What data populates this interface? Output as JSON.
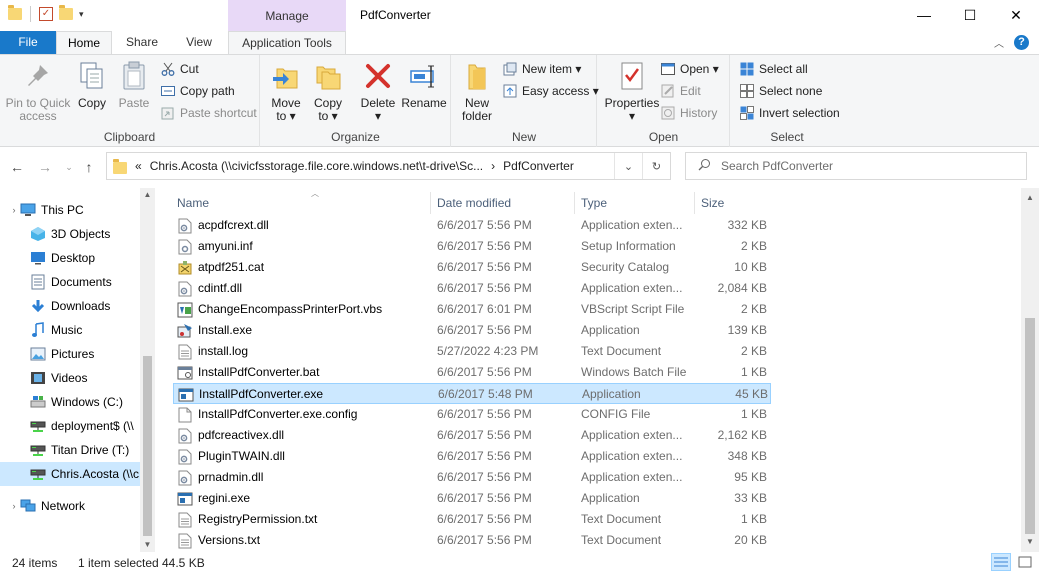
{
  "titlebar": {
    "manage_label": "Manage",
    "window_title": "PdfConverter",
    "minimize": "—",
    "maximize": "☐",
    "close": "✕"
  },
  "tabs": {
    "file": "File",
    "home": "Home",
    "share": "Share",
    "view": "View",
    "app_tools": "Application Tools"
  },
  "ribbon": {
    "clipboard": {
      "label": "Clipboard",
      "pin_line1": "Pin to Quick",
      "pin_line2": "access",
      "copy": "Copy",
      "paste": "Paste",
      "cut": "Cut",
      "copy_path": "Copy path",
      "paste_shortcut": "Paste shortcut"
    },
    "organize": {
      "label": "Organize",
      "move_to_l1": "Move",
      "move_to_l2": "to ▾",
      "copy_to_l1": "Copy",
      "copy_to_l2": "to ▾",
      "delete_l1": "Delete",
      "delete_l2": "▾",
      "rename": "Rename"
    },
    "new": {
      "label": "New",
      "new_folder_l1": "New",
      "new_folder_l2": "folder",
      "new_item": "New item ▾",
      "easy_access": "Easy access ▾"
    },
    "open": {
      "label": "Open",
      "properties_l1": "Properties",
      "properties_l2": "▾",
      "open": "Open ▾",
      "edit": "Edit",
      "history": "History"
    },
    "select": {
      "label": "Select",
      "select_all": "Select all",
      "select_none": "Select none",
      "invert": "Invert selection"
    }
  },
  "address": {
    "prefix": "«",
    "crumb1": "Chris.Acosta (\\\\civicfsstorage.file.core.windows.net\\t-drive\\Sc...",
    "sep": "›",
    "crumb2": "PdfConverter",
    "search_placeholder": "Search PdfConverter"
  },
  "navpane": {
    "items": [
      {
        "label": "This PC",
        "icon": "this-pc-icon"
      },
      {
        "label": "3D Objects",
        "icon": "3d-objects-icon"
      },
      {
        "label": "Desktop",
        "icon": "desktop-icon"
      },
      {
        "label": "Documents",
        "icon": "documents-icon"
      },
      {
        "label": "Downloads",
        "icon": "downloads-icon"
      },
      {
        "label": "Music",
        "icon": "music-icon"
      },
      {
        "label": "Pictures",
        "icon": "pictures-icon"
      },
      {
        "label": "Videos",
        "icon": "videos-icon"
      },
      {
        "label": "Windows (C:)",
        "icon": "drive-icon"
      },
      {
        "label": "deployment$ (\\\\",
        "icon": "network-drive-icon"
      },
      {
        "label": "Titan Drive (T:)",
        "icon": "network-drive-icon"
      },
      {
        "label": "Chris.Acosta (\\\\c",
        "icon": "network-drive-icon"
      },
      {
        "label": "Network",
        "icon": "network-icon"
      }
    ]
  },
  "columns": {
    "name": "Name",
    "date": "Date modified",
    "type": "Type",
    "size": "Size"
  },
  "files": [
    {
      "name": "acpdfcrext.dll",
      "date": "6/6/2017 5:56 PM",
      "type": "Application exten...",
      "size": "332 KB",
      "icon": "dll"
    },
    {
      "name": "amyuni.inf",
      "date": "6/6/2017 5:56 PM",
      "type": "Setup Information",
      "size": "2 KB",
      "icon": "inf"
    },
    {
      "name": "atpdf251.cat",
      "date": "6/6/2017 5:56 PM",
      "type": "Security Catalog",
      "size": "10 KB",
      "icon": "cat"
    },
    {
      "name": "cdintf.dll",
      "date": "6/6/2017 5:56 PM",
      "type": "Application exten...",
      "size": "2,084 KB",
      "icon": "dll"
    },
    {
      "name": "ChangeEncompassPrinterPort.vbs",
      "date": "6/6/2017 6:01 PM",
      "type": "VBScript Script File",
      "size": "2 KB",
      "icon": "vbs"
    },
    {
      "name": "Install.exe",
      "date": "6/6/2017 5:56 PM",
      "type": "Application",
      "size": "139 KB",
      "icon": "installer"
    },
    {
      "name": "install.log",
      "date": "5/27/2022 4:23 PM",
      "type": "Text Document",
      "size": "2 KB",
      "icon": "txt"
    },
    {
      "name": "InstallPdfConverter.bat",
      "date": "6/6/2017 5:56 PM",
      "type": "Windows Batch File",
      "size": "1 KB",
      "icon": "bat"
    },
    {
      "name": "InstallPdfConverter.exe",
      "date": "6/6/2017 5:48 PM",
      "type": "Application",
      "size": "45 KB",
      "icon": "exe",
      "selected": true
    },
    {
      "name": "InstallPdfConverter.exe.config",
      "date": "6/6/2017 5:56 PM",
      "type": "CONFIG File",
      "size": "1 KB",
      "icon": "blank"
    },
    {
      "name": "pdfcreactivex.dll",
      "date": "6/6/2017 5:56 PM",
      "type": "Application exten...",
      "size": "2,162 KB",
      "icon": "dll"
    },
    {
      "name": "PluginTWAIN.dll",
      "date": "6/6/2017 5:56 PM",
      "type": "Application exten...",
      "size": "348 KB",
      "icon": "dll"
    },
    {
      "name": "prnadmin.dll",
      "date": "6/6/2017 5:56 PM",
      "type": "Application exten...",
      "size": "95 KB",
      "icon": "dll"
    },
    {
      "name": "regini.exe",
      "date": "6/6/2017 5:56 PM",
      "type": "Application",
      "size": "33 KB",
      "icon": "exe"
    },
    {
      "name": "RegistryPermission.txt",
      "date": "6/6/2017 5:56 PM",
      "type": "Text Document",
      "size": "1 KB",
      "icon": "txt"
    },
    {
      "name": "Versions.txt",
      "date": "6/6/2017 5:56 PM",
      "type": "Text Document",
      "size": "20 KB",
      "icon": "txt"
    }
  ],
  "status": {
    "item_count": "24 items",
    "selected": "1 item selected",
    "selected_size": "44.5 KB"
  },
  "colors": {
    "accent": "#1979ca",
    "manage_bg": "#e8d9f7",
    "selection": "#cce8ff"
  }
}
